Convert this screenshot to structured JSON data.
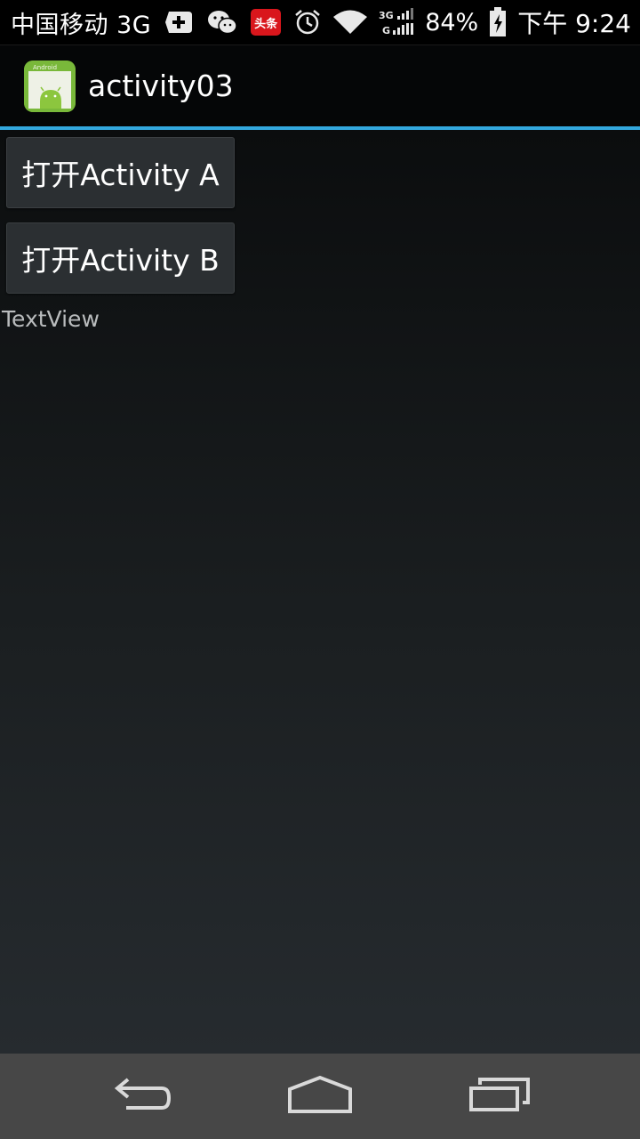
{
  "status_bar": {
    "carrier": "中国移动 3G",
    "network_label_top": "3G",
    "network_label_bottom": "G",
    "battery": "84%",
    "time": "下午 9:24",
    "icons": [
      "plus-notification-icon",
      "wechat-icon",
      "toutiao-icon",
      "alarm-icon",
      "wifi-icon",
      "signal-icon",
      "battery-charging-icon"
    ],
    "toutiao_text": "头条"
  },
  "action_bar": {
    "title": "activity03",
    "icon": "android-app-icon",
    "icon_text": "Android",
    "accent_color": "#33a8de"
  },
  "content": {
    "buttons": [
      {
        "label": "打开Activity A"
      },
      {
        "label": "打开Activity B"
      }
    ],
    "textview": "TextView"
  },
  "nav_bar": {
    "icons": [
      "back-icon",
      "home-icon",
      "recent-apps-icon"
    ]
  }
}
